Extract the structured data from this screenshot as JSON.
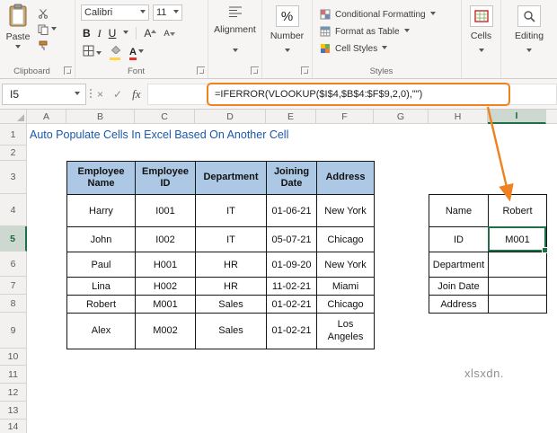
{
  "ribbon": {
    "clipboard": {
      "paste_label": "Paste",
      "group_label": "Clipboard"
    },
    "font": {
      "family": "Calibri",
      "size": "11",
      "bold": "B",
      "italic": "I",
      "underline": "U",
      "grow": "A",
      "shrink": "A",
      "font_color": "A",
      "group_label": "Font"
    },
    "alignment": {
      "label": "Alignment"
    },
    "number": {
      "label": "Number",
      "percent": "%"
    },
    "styles": {
      "items": [
        "Conditional Formatting",
        "Format as Table",
        "Cell Styles"
      ],
      "group_label": "Styles"
    },
    "cells": {
      "label": "Cells"
    },
    "editing": {
      "label": "Editing"
    }
  },
  "formula_bar": {
    "cell_ref": "I5",
    "cancel_icon": "×",
    "enter_icon": "✓",
    "fx_label": "fx",
    "formula": "=IFERROR(VLOOKUP($I$4,$B$4:$F$9,2,0),\"\")"
  },
  "sheet": {
    "title": "Auto Populate Cells In Excel Based On Another Cell",
    "columns": [
      "A",
      "B",
      "C",
      "D",
      "E",
      "F",
      "G",
      "H",
      "I"
    ],
    "rows": [
      "1",
      "2",
      "3",
      "4",
      "5",
      "6",
      "7",
      "8",
      "9",
      "10",
      "11",
      "12",
      "13",
      "14"
    ],
    "selected_cell": "I5"
  },
  "employee_table": {
    "headers": [
      "Employee Name",
      "Employee ID",
      "Department",
      "Joining Date",
      "Address"
    ],
    "rows": [
      [
        "Harry",
        "I001",
        "IT",
        "01-06-21",
        "New York"
      ],
      [
        "John",
        "I002",
        "IT",
        "05-07-21",
        "Chicago"
      ],
      [
        "Paul",
        "H001",
        "HR",
        "01-09-20",
        "New York"
      ],
      [
        "Lina",
        "H002",
        "HR",
        "11-02-21",
        "Miami"
      ],
      [
        "Robert",
        "M001",
        "Sales",
        "01-02-21",
        "Chicago"
      ],
      [
        "Alex",
        "M002",
        "Sales",
        "01-02-21",
        "Los Angeles"
      ]
    ]
  },
  "lookup_table": {
    "labels": [
      "Name",
      "ID",
      "Department",
      "Join Date",
      "Address"
    ],
    "values": [
      "Robert",
      "M001",
      "",
      "",
      ""
    ]
  },
  "annotations": {
    "watermark": "xlsxdn."
  },
  "colors": {
    "accent_orange": "#F0811F",
    "selection_green": "#1E7145",
    "value_green": "#00B050",
    "value_red": "#FF0000",
    "table_header_blue": "#ACC8E4",
    "title_blue": "#1A58A8"
  }
}
